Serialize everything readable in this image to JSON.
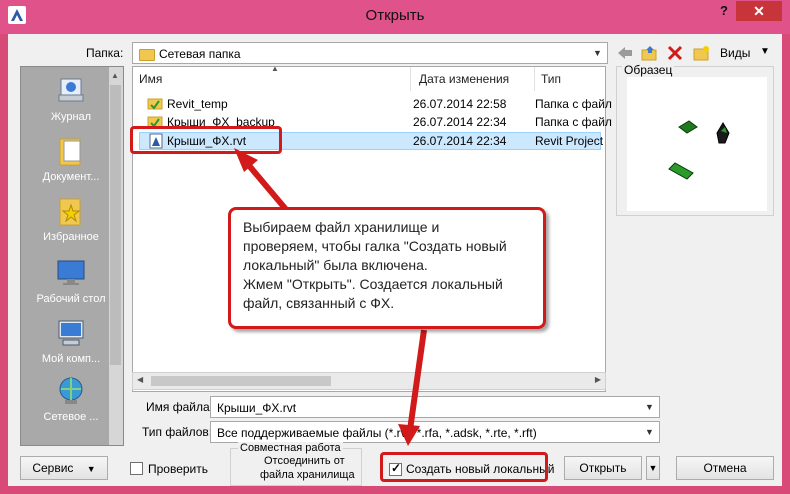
{
  "window": {
    "title": "Открыть",
    "help_label": "?",
    "close_label": "✕"
  },
  "toolbar": {
    "folder_label": "Папка:",
    "folder_value": "Сетевая папка",
    "views_label": "Виды"
  },
  "places": [
    {
      "label": "Журнал",
      "icon": "history-icon"
    },
    {
      "label": "Документ...",
      "icon": "documents-icon"
    },
    {
      "label": "Избранное",
      "icon": "favorites-icon"
    },
    {
      "label": "Рабочий стол",
      "icon": "desktop-icon"
    },
    {
      "label": "Мой комп...",
      "icon": "computer-icon"
    },
    {
      "label": "Сетевое ...",
      "icon": "network-icon"
    }
  ],
  "filelist": {
    "columns": [
      "Имя",
      "Дата изменения",
      "Тип"
    ],
    "rows": [
      {
        "name": "Revit_temp",
        "date": "26.07.2014 22:58",
        "type": "Папка с файл",
        "icon": "folder-icon"
      },
      {
        "name": "Крыши_ФХ_backup",
        "date": "26.07.2014 22:34",
        "type": "Папка с файл",
        "icon": "folder-icon"
      },
      {
        "name": "Крыши_ФХ.rvt",
        "date": "26.07.2014 22:34",
        "type": "Revit Project",
        "icon": "revit-file-icon",
        "selected": true
      }
    ]
  },
  "preview": {
    "label": "Образец"
  },
  "filename": {
    "label": "Имя файла:",
    "value": "Крыши_ФХ.rvt"
  },
  "filetype": {
    "label": "Тип файлов:",
    "value": "Все поддерживаемые файлы  (*.rvt, *.rfa, *.adsk, *.rte, *.rft)"
  },
  "footer": {
    "service_label": "Сервис",
    "verify_label": "Проверить",
    "worksharing_group": "Совместная работа",
    "detach_label_1": "Отсоединить от",
    "detach_label_2": "файла хранилища",
    "create_local_label": "Создать новый локальный",
    "open_label": "Открыть",
    "cancel_label": "Отмена"
  },
  "callout": {
    "line1": "Выбираем файл хранилище и",
    "line2": "проверяем, чтобы галка \"Создать новый",
    "line3": "локальный\" была включена.",
    "line4": "Жмем \"Открыть\". Создается локальный",
    "line5": "файл, связанный с ФХ."
  },
  "colors": {
    "title_bar": "#e0528a",
    "annotation_red": "#d21a1a",
    "selection": "#cce8ff"
  }
}
